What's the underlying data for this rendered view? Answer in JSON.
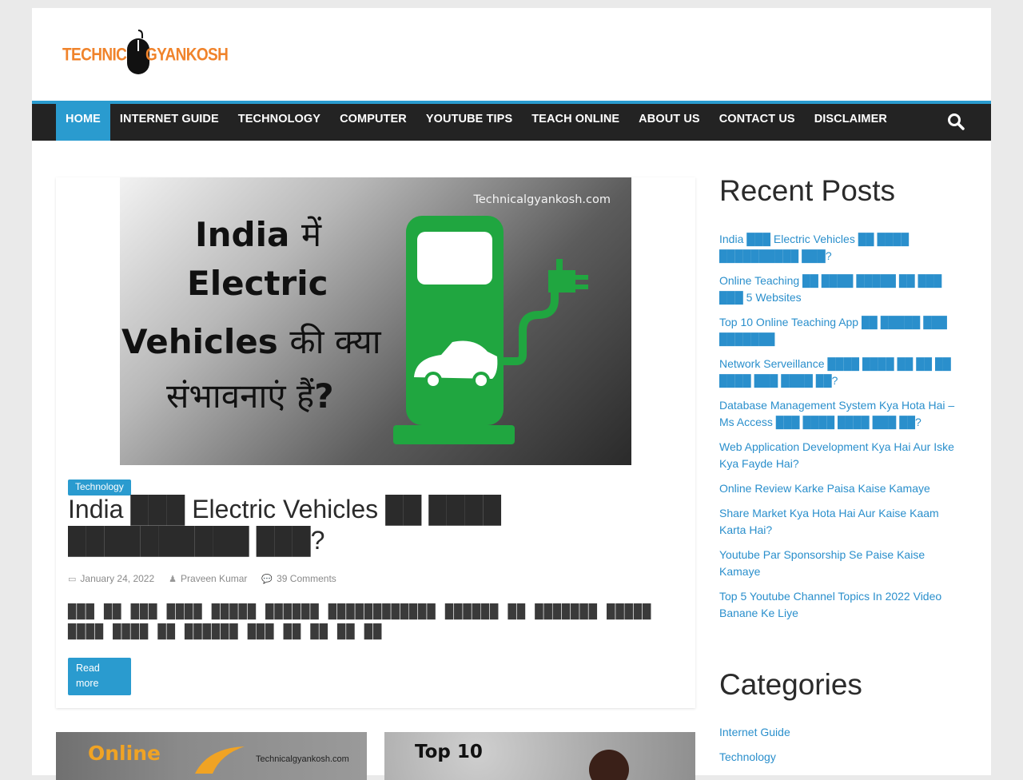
{
  "logo": {
    "word1": "TECHNICAL",
    "word2": "GYANKOSH",
    "color": "#f0832b"
  },
  "nav": {
    "items": [
      "HOME",
      "INTERNET GUIDE",
      "TECHNOLOGY",
      "COMPUTER",
      "YOUTUBE TIPS",
      "TEACH ONLINE",
      "ABOUT US",
      "CONTACT US",
      "DISCLAIMER"
    ],
    "active": "HOME",
    "accent": "#2a9bcf"
  },
  "post": {
    "image": {
      "watermark": "Technicalgyankosh.com",
      "line1_a": "India",
      "line1_b": "में",
      "line2": "Electric",
      "line3_a": "Vehicles",
      "line3_b": "की क्या",
      "line4_a": "संभावनाएं हैं",
      "line4_b": "?"
    },
    "category": "Technology",
    "title": "India ███ Electric Vehicles ██ ████ ██████████ ███?",
    "date": "January 24, 2022",
    "author": "Praveen Kumar",
    "comments": "39 Comments",
    "excerpt": "███ ██ ███ ████ █████ ██████ ████████████ ██████ ██ ███████ █████ ████ ████ ██ ██████ ███ ██ ██  ██ ██",
    "read_more": "Read more"
  },
  "thumbs": [
    {
      "title": "Online",
      "watermark": "Technicalgyankosh.com"
    },
    {
      "title": "Top 10"
    }
  ],
  "sidebar": {
    "recent_heading": "Recent Posts",
    "recent_posts": [
      "India ███ Electric Vehicles ██ ████ ██████████ ███?",
      "Online Teaching ██ ████ █████ ██ ███ ███ 5 Websites",
      "Top 10 Online Teaching App ██ █████ ███ ███████",
      "Network Serveillance ████ ████ ██ ██ ██ ████ ███ ████ ██?",
      "Database Management System Kya Hota Hai – Ms Access ███ ████ ████ ███ ██?",
      "Web Application Development Kya Hai Aur Iske Kya Fayde Hai?",
      "Online Review Karke Paisa Kaise Kamaye",
      "Share Market Kya Hota Hai Aur Kaise Kaam Karta Hai?",
      "Youtube Par Sponsorship Se Paise Kaise Kamaye",
      "Top 5 Youtube Channel Topics In 2022 Video Banane Ke Liye"
    ],
    "categories_heading": "Categories",
    "categories": [
      "Internet Guide",
      "Technology"
    ],
    "link_color": "#2a8fcc"
  }
}
